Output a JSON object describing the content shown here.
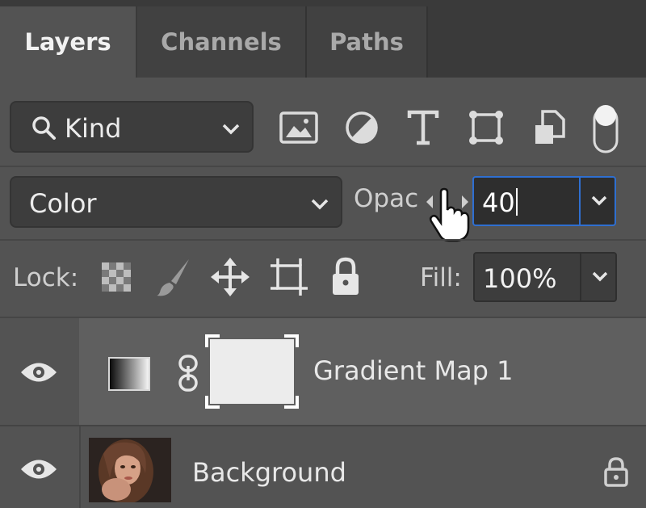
{
  "tabs": [
    {
      "label": "Layers",
      "active": true
    },
    {
      "label": "Channels",
      "active": false
    },
    {
      "label": "Paths",
      "active": false
    }
  ],
  "filter": {
    "label": "Kind",
    "icons": [
      "image-filter-icon",
      "adjustment-filter-icon",
      "type-filter-icon",
      "shape-filter-icon",
      "smart-object-filter-icon",
      "filter-toggle-icon"
    ]
  },
  "blend": {
    "mode": "Color",
    "opacity_label": "Opac",
    "opacity_value": "40"
  },
  "lock": {
    "label": "Lock:",
    "icons": [
      "lock-transparent-pixels-icon",
      "lock-image-pixels-icon",
      "lock-position-icon",
      "lock-artboard-icon",
      "lock-all-icon"
    ]
  },
  "fill": {
    "label": "Fill:",
    "value": "100%"
  },
  "layers": [
    {
      "name": "Gradient Map 1",
      "type": "adjustment",
      "visible": true,
      "selected": true
    },
    {
      "name": "Background",
      "type": "image",
      "visible": true,
      "locked": true,
      "selected": false
    }
  ],
  "colors": {
    "panel_bg": "#535353",
    "tab_bar_bg": "#3a3a3a",
    "field_bg": "#3d3d3d",
    "focus_accent": "#2f6fd1",
    "selected_layer_bg": "#5f5f5f"
  }
}
